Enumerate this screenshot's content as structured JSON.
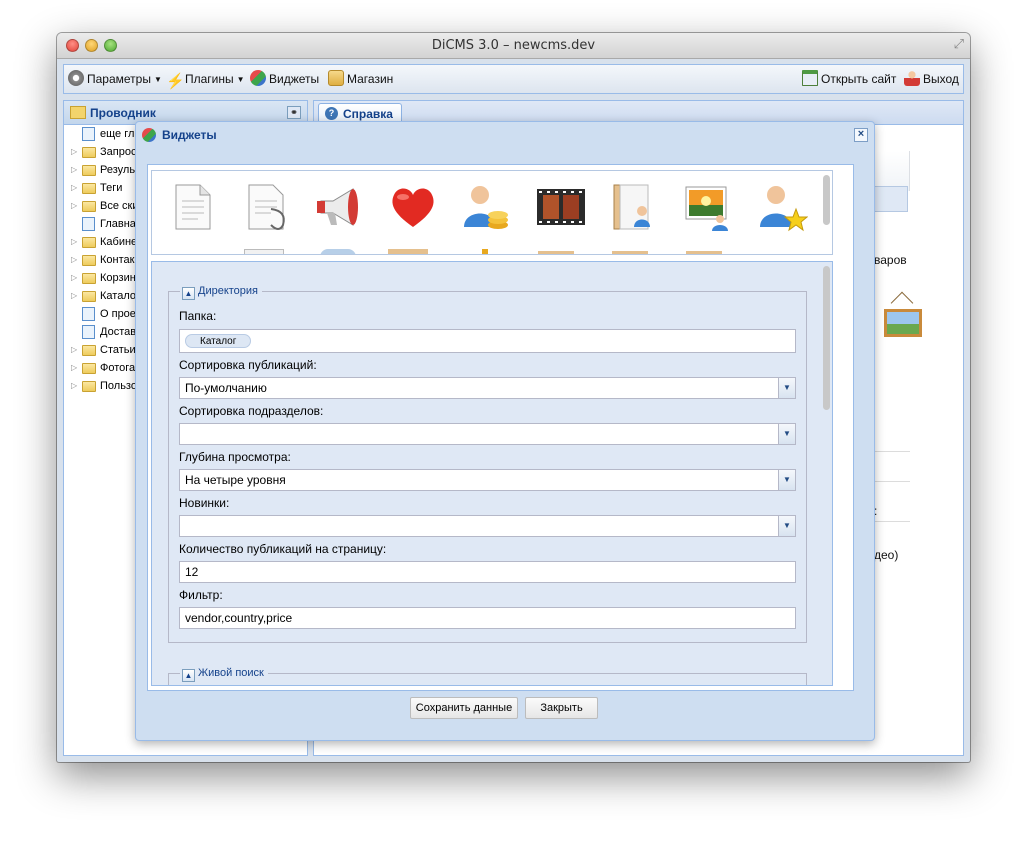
{
  "window": {
    "title": "DiCMS 3.0 – newcms.dev"
  },
  "toolbar": {
    "items": [
      {
        "label": "Параметры",
        "icon": "gear-icon"
      },
      {
        "label": "Плагины",
        "icon": "lightning-icon"
      },
      {
        "label": "Виджеты",
        "icon": "widgets-icon"
      },
      {
        "label": "Магазин",
        "icon": "box-icon"
      }
    ],
    "open_site_label": "Открыть сайт",
    "logout_label": "Выход"
  },
  "explorer": {
    "title": "Проводник",
    "items": [
      {
        "label": "еще гл",
        "type": "page"
      },
      {
        "label": "Запрос",
        "type": "folder"
      },
      {
        "label": "Резуль",
        "type": "folder"
      },
      {
        "label": "Теги",
        "type": "folder"
      },
      {
        "label": "Все ски",
        "type": "folder"
      },
      {
        "label": "Главна",
        "type": "page"
      },
      {
        "label": "Кабине",
        "type": "folder"
      },
      {
        "label": "Контак",
        "type": "folder"
      },
      {
        "label": "Корзин",
        "type": "folder"
      },
      {
        "label": "Катало",
        "type": "folder"
      },
      {
        "label": "О прое",
        "type": "page"
      },
      {
        "label": "Достав",
        "type": "page"
      },
      {
        "label": "Статьи",
        "type": "folder"
      },
      {
        "label": "Фотога",
        "type": "folder"
      },
      {
        "label": "Пользо",
        "type": "folder"
      }
    ]
  },
  "right": {
    "tab_label": "Справка",
    "bg_text_1": "варов",
    "bg_text_2": "деo)",
    "bg_text_3": ":"
  },
  "dialog": {
    "title": "Виджеты",
    "sections": {
      "directory": "Директория",
      "live_search": "Живой поиск"
    },
    "fields": {
      "folder_label": "Папка:",
      "folder_chip": "Каталог",
      "sort_pubs_label": "Сортировка публикаций:",
      "sort_pubs_value": "По-умолчанию",
      "sort_subs_label": "Сортировка подразделов:",
      "sort_subs_value": "",
      "depth_label": "Глубина просмотра:",
      "depth_value": "На четыре уровня",
      "new_label": "Новинки:",
      "new_value": "",
      "count_label": "Количество публикаций на страницу:",
      "count_value": "12",
      "filter_label": "Фильтр:",
      "filter_value": "vendor,country,price"
    },
    "buttons": {
      "save": "Сохранить данные",
      "close": "Закрыть"
    },
    "widget_icons": [
      "document-icon",
      "document-attach-icon",
      "megaphone-icon",
      "heart-icon",
      "user-coins-icon",
      "filmstrip-icon",
      "contact-card-icon",
      "picture-user-icon",
      "user-star-icon"
    ]
  }
}
